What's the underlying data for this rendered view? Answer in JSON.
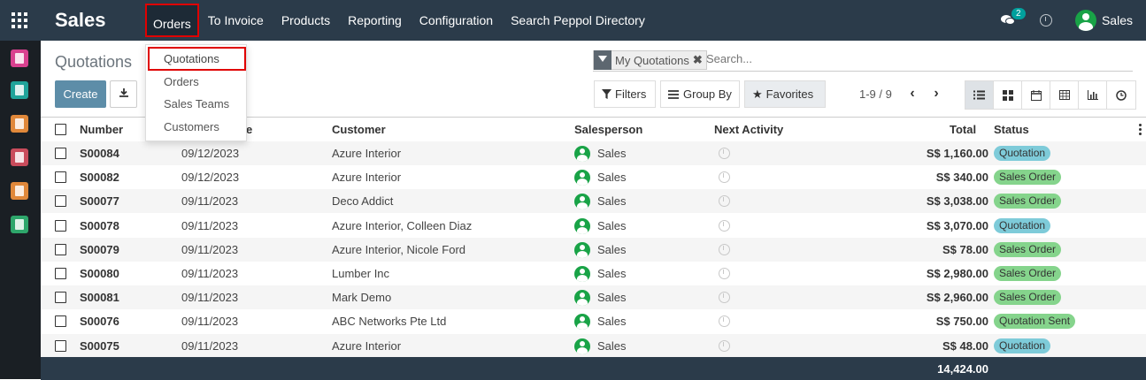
{
  "topbar": {
    "app_title": "Sales",
    "menu": [
      "Orders",
      "To Invoice",
      "Products",
      "Reporting",
      "Configuration",
      "Search Peppol Directory"
    ],
    "chat_badge": "2",
    "user_name": "Sales"
  },
  "dropdown": [
    "Quotations",
    "Orders",
    "Sales Teams",
    "Customers"
  ],
  "control": {
    "title": "Quotations",
    "create_label": "Create",
    "facet_label": "My Quotations",
    "search_placeholder": "Search...",
    "filters_label": "Filters",
    "groupby_label": "Group By",
    "favorites_label": "Favorites",
    "pager": "1-9 / 9"
  },
  "table": {
    "headers": {
      "number": "Number",
      "date": "e",
      "customer": "Customer",
      "salesperson": "Salesperson",
      "activity": "Next Activity",
      "total": "Total",
      "status": "Status"
    },
    "rows": [
      {
        "number": "S00084",
        "date": "09/12/2023",
        "customer": "Azure Interior",
        "salesperson": "Sales",
        "total": "S$ 1,160.00",
        "status": "Quotation"
      },
      {
        "number": "S00082",
        "date": "09/12/2023",
        "customer": "Azure Interior",
        "salesperson": "Sales",
        "total": "S$ 340.00",
        "status": "Sales Order"
      },
      {
        "number": "S00077",
        "date": "09/11/2023",
        "customer": "Deco Addict",
        "salesperson": "Sales",
        "total": "S$ 3,038.00",
        "status": "Sales Order"
      },
      {
        "number": "S00078",
        "date": "09/11/2023",
        "customer": "Azure Interior, Colleen Diaz",
        "salesperson": "Sales",
        "total": "S$ 3,070.00",
        "status": "Quotation"
      },
      {
        "number": "S00079",
        "date": "09/11/2023",
        "customer": "Azure Interior, Nicole Ford",
        "salesperson": "Sales",
        "total": "S$ 78.00",
        "status": "Sales Order"
      },
      {
        "number": "S00080",
        "date": "09/11/2023",
        "customer": "Lumber Inc",
        "salesperson": "Sales",
        "total": "S$ 2,980.00",
        "status": "Sales Order"
      },
      {
        "number": "S00081",
        "date": "09/11/2023",
        "customer": "Mark Demo",
        "salesperson": "Sales",
        "total": "S$ 2,960.00",
        "status": "Sales Order"
      },
      {
        "number": "S00076",
        "date": "09/11/2023",
        "customer": "ABC Networks Pte Ltd",
        "salesperson": "Sales",
        "total": "S$ 750.00",
        "status": "Quotation Sent"
      },
      {
        "number": "S00075",
        "date": "09/11/2023",
        "customer": "Azure Interior",
        "salesperson": "Sales",
        "total": "S$ 48.00",
        "status": "Quotation"
      }
    ],
    "grand_total": "14,424.00"
  },
  "status_colors": {
    "Quotation": "#7ecbd9",
    "Sales Order": "#85d48c",
    "Quotation Sent": "#85d48c"
  },
  "sidebar_icons": [
    {
      "name": "discuss-icon",
      "color": "#d9408f"
    },
    {
      "name": "contacts-icon",
      "color": "#1fa39a"
    },
    {
      "name": "crm-icon",
      "color": "#e0883a"
    },
    {
      "name": "sales-icon",
      "color": "#c94c5c"
    },
    {
      "name": "invoicing-icon",
      "color": "#e0883a"
    },
    {
      "name": "documents-icon",
      "color": "#2ea66b"
    }
  ]
}
